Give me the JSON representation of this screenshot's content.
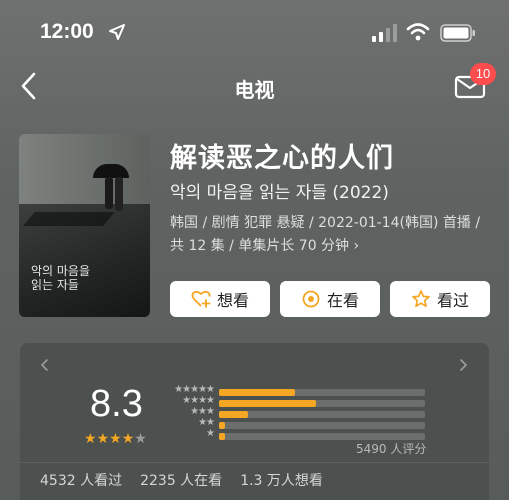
{
  "status_bar": {
    "time": "12:00"
  },
  "nav": {
    "title": "电视",
    "badge": "10"
  },
  "show": {
    "title": "解读恶之心的人们",
    "original_title": "악의 마음을 읽는 자들 (2022)",
    "meta_line1": "韩国 / 剧情 犯罪 悬疑 / 2022-01-14(韩国) 首播 /",
    "meta_line2": "共 12 集 / 单集片长 70 分钟 ›",
    "poster_text": "악의 마음을 읽는 자들"
  },
  "actions": {
    "want": "想看",
    "watching": "在看",
    "watched": "看过"
  },
  "rating": {
    "score": "8.3",
    "stars_filled": 4,
    "stars_total": 5,
    "distribution": [
      {
        "stars": "★★★★★",
        "fraction": 0.37
      },
      {
        "stars": "★★★★",
        "fraction": 0.47
      },
      {
        "stars": "★★★",
        "fraction": 0.14
      },
      {
        "stars": "★★",
        "fraction": 0.03
      },
      {
        "stars": "★",
        "fraction": 0.03
      }
    ],
    "rating_count": "5490 人评分"
  },
  "stats": {
    "watched": "4532 人看过",
    "watching": "2235 人在看",
    "want": "1.3 万人想看"
  },
  "colors": {
    "accent": "#f5a623",
    "badge": "#ff4c4c"
  }
}
